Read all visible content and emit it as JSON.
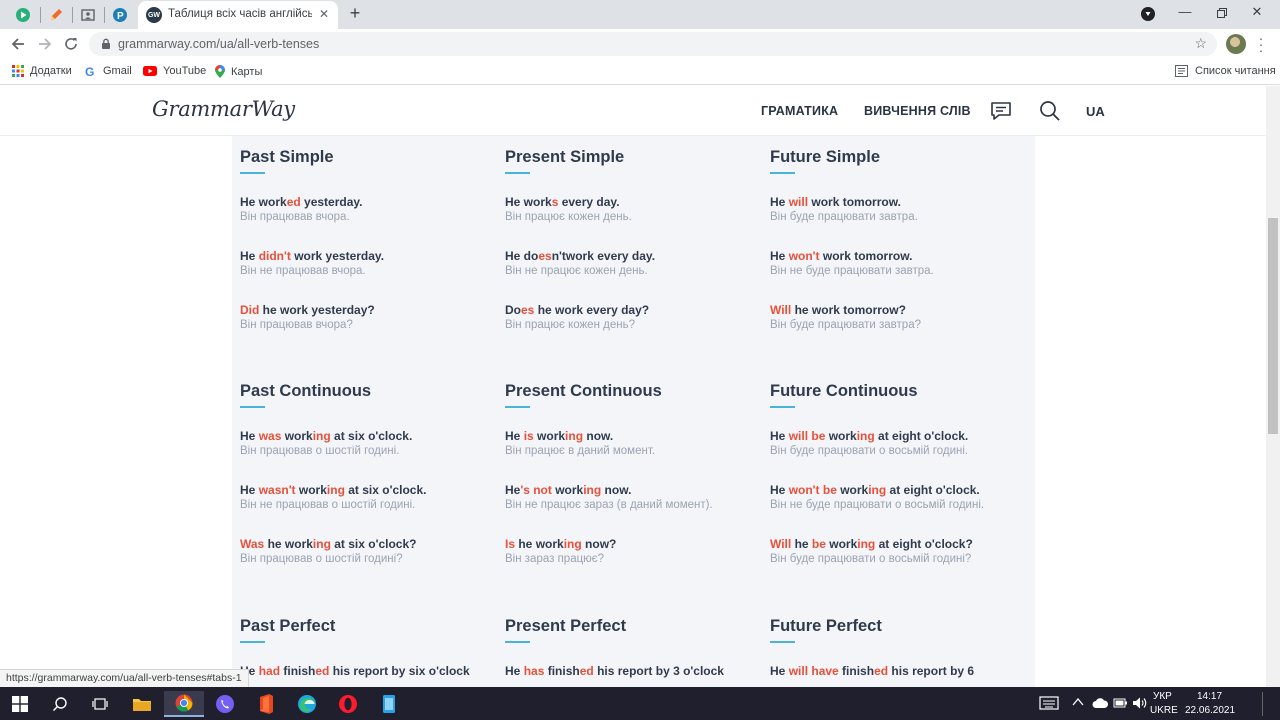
{
  "browser": {
    "tab_title": "Таблиця всіх часів англійської м",
    "tab_favicon": "GW",
    "url": "grammarway.com/ua/all-verb-tenses",
    "status_url": "https://grammarway.com/ua/all-verb-tenses#tabs-1",
    "bookmarks": [
      {
        "label": "Додатки",
        "icon": "apps-grid-icon"
      },
      {
        "label": "Gmail",
        "icon": "google-icon"
      },
      {
        "label": "YouTube",
        "icon": "youtube-icon"
      },
      {
        "label": "Карты",
        "icon": "maps-pin-icon"
      }
    ],
    "reading_list": "Список читання"
  },
  "site": {
    "logo": "GrammarWay",
    "nav": [
      "ГРАМАТИКА",
      "ВИВЧЕННЯ СЛІВ"
    ],
    "lang": "UA"
  },
  "tenses": [
    {
      "title": "Past Simple",
      "examples": [
        {
          "en": [
            [
              "He work",
              0
            ],
            [
              "ed",
              1
            ],
            [
              " yesterday.",
              0
            ]
          ],
          "ua": "Він працював вчора."
        },
        {
          "en": [
            [
              "He ",
              0
            ],
            [
              "didn't",
              1
            ],
            [
              " work yesterday.",
              0
            ]
          ],
          "ua": "Він не працював вчора."
        },
        {
          "en": [
            [
              "Did",
              1
            ],
            [
              " he work yesterday?",
              0
            ]
          ],
          "ua": "Він працював вчора?"
        }
      ]
    },
    {
      "title": "Present Simple",
      "examples": [
        {
          "en": [
            [
              "He work",
              0
            ],
            [
              "s",
              1
            ],
            [
              " every day.",
              0
            ]
          ],
          "ua": "Він працює кожен день."
        },
        {
          "en": [
            [
              "He do",
              0
            ],
            [
              "es",
              1
            ],
            [
              "n'twork every day.",
              0
            ]
          ],
          "ua": "Він не працює кожен день."
        },
        {
          "en": [
            [
              "Do",
              0
            ],
            [
              "es",
              1
            ],
            [
              " he work every day?",
              0
            ]
          ],
          "ua": "Він працює кожен день?"
        }
      ]
    },
    {
      "title": "Future Simple",
      "examples": [
        {
          "en": [
            [
              "He ",
              0
            ],
            [
              "will",
              1
            ],
            [
              " work tomorrow.",
              0
            ]
          ],
          "ua": "Він буде працювати завтра."
        },
        {
          "en": [
            [
              "He ",
              0
            ],
            [
              "won't",
              1
            ],
            [
              " work tomorrow.",
              0
            ]
          ],
          "ua": "Він не буде працювати завтра."
        },
        {
          "en": [
            [
              "Will",
              1
            ],
            [
              " he work tomorrow?",
              0
            ]
          ],
          "ua": "Він буде працювати завтра?"
        }
      ]
    },
    {
      "title": "Past Continuous",
      "examples": [
        {
          "en": [
            [
              "He ",
              0
            ],
            [
              "was",
              1
            ],
            [
              " work",
              0
            ],
            [
              "ing",
              1
            ],
            [
              " at six o'clock.",
              0
            ]
          ],
          "ua": "Він працював о шостій годині."
        },
        {
          "en": [
            [
              "He ",
              0
            ],
            [
              "wasn't",
              1
            ],
            [
              " work",
              0
            ],
            [
              "ing",
              1
            ],
            [
              " at six o'clock.",
              0
            ]
          ],
          "ua": "Він не працював о шостій годині."
        },
        {
          "en": [
            [
              "Was",
              1
            ],
            [
              " he work",
              0
            ],
            [
              "ing",
              1
            ],
            [
              " at six o'clock?",
              0
            ]
          ],
          "ua": "Він працював о шостій годині?"
        }
      ]
    },
    {
      "title": "Present Continuous",
      "examples": [
        {
          "en": [
            [
              "He ",
              0
            ],
            [
              "is",
              1
            ],
            [
              " work",
              0
            ],
            [
              "ing",
              1
            ],
            [
              " now.",
              0
            ]
          ],
          "ua": "Він працює в даний момент."
        },
        {
          "en": [
            [
              "He",
              0
            ],
            [
              "'s not",
              1
            ],
            [
              " work",
              0
            ],
            [
              "ing",
              1
            ],
            [
              " now.",
              0
            ]
          ],
          "ua": "Він не працює зараз (в даний момент)."
        },
        {
          "en": [
            [
              "Is",
              1
            ],
            [
              " he work",
              0
            ],
            [
              "ing",
              1
            ],
            [
              " now?",
              0
            ]
          ],
          "ua": "Він зараз працює?"
        }
      ]
    },
    {
      "title": "Future Continuous",
      "examples": [
        {
          "en": [
            [
              "He ",
              0
            ],
            [
              "will be",
              1
            ],
            [
              " work",
              0
            ],
            [
              "ing",
              1
            ],
            [
              " at eight o'clock.",
              0
            ]
          ],
          "ua": "Він буде працювати о восьмій годині."
        },
        {
          "en": [
            [
              "He ",
              0
            ],
            [
              "won't be",
              1
            ],
            [
              " work",
              0
            ],
            [
              "ing",
              1
            ],
            [
              " at eight o'clock.",
              0
            ]
          ],
          "ua": "Він не буде працювати о восьмій годині."
        },
        {
          "en": [
            [
              "Will",
              1
            ],
            [
              " he ",
              0
            ],
            [
              "be",
              1
            ],
            [
              " work",
              0
            ],
            [
              "ing",
              1
            ],
            [
              " at eight o'clock?",
              0
            ]
          ],
          "ua": "Він буде працювати о восьмій годині?"
        }
      ]
    },
    {
      "title": "Past Perfect",
      "examples": [
        {
          "en": [
            [
              "He ",
              0
            ],
            [
              "had",
              1
            ],
            [
              " finish",
              0
            ],
            [
              "ed",
              1
            ],
            [
              " his report by six o'clock",
              0
            ]
          ],
          "ua": ""
        }
      ]
    },
    {
      "title": "Present Perfect",
      "examples": [
        {
          "en": [
            [
              "He ",
              0
            ],
            [
              "has",
              1
            ],
            [
              " finish",
              0
            ],
            [
              "ed",
              1
            ],
            [
              " his report by 3 o'clock",
              0
            ]
          ],
          "ua": ""
        }
      ]
    },
    {
      "title": "Future Perfect",
      "examples": [
        {
          "en": [
            [
              "He ",
              0
            ],
            [
              "will have",
              1
            ],
            [
              " finish",
              0
            ],
            [
              "ed",
              1
            ],
            [
              " his report by 6",
              0
            ]
          ],
          "ua": ""
        }
      ]
    }
  ],
  "taskbar": {
    "lang_top": "УКР",
    "lang_bottom": "UKRE",
    "time": "14:17",
    "date": "22.06.2021"
  },
  "colors": {
    "highlight": "#e8503a",
    "accent_underline": "#4ab3d9",
    "panel_bg": "#f4f5f9"
  }
}
